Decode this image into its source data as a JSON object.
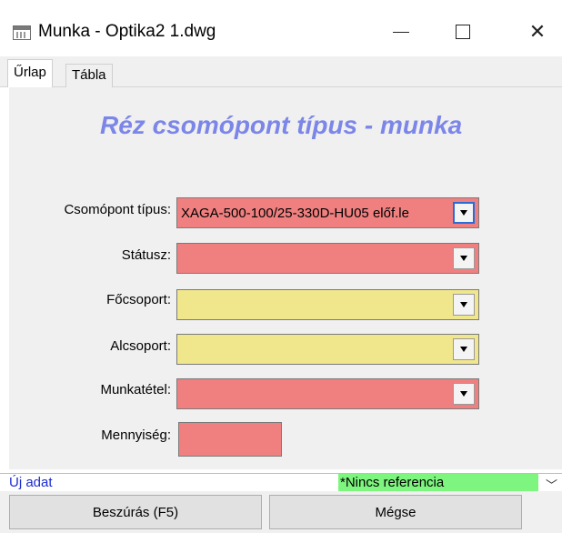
{
  "window": {
    "title": "Munka - Optika2 1.dwg"
  },
  "tabs": [
    {
      "label": "Űrlap"
    },
    {
      "label": "Tábla"
    }
  ],
  "form": {
    "heading": "Réz csomópont típus - munka",
    "fields": [
      {
        "label": "Csomópont típus:",
        "value": "XAGA-500-100/25-330D-HU05 előf.le",
        "color": "#f08080"
      },
      {
        "label": "Státusz:",
        "value": "",
        "color": "#f08080"
      },
      {
        "label": "Főcsoport:",
        "value": "",
        "color": "#f0e68c"
      },
      {
        "label": "Alcsoport:",
        "value": "",
        "color": "#f0e68c"
      },
      {
        "label": "Munkatétel:",
        "value": "",
        "color": "#f08080"
      },
      {
        "label": "Mennyiség:",
        "value": "",
        "color": "#f08080"
      }
    ]
  },
  "status": {
    "left_text": "Új adat",
    "reference_text": "*Nincs referencia",
    "reference_color": "#7ef57e"
  },
  "buttons": {
    "insert_label": "Beszúrás (F5)",
    "cancel_label": "Mégse"
  }
}
